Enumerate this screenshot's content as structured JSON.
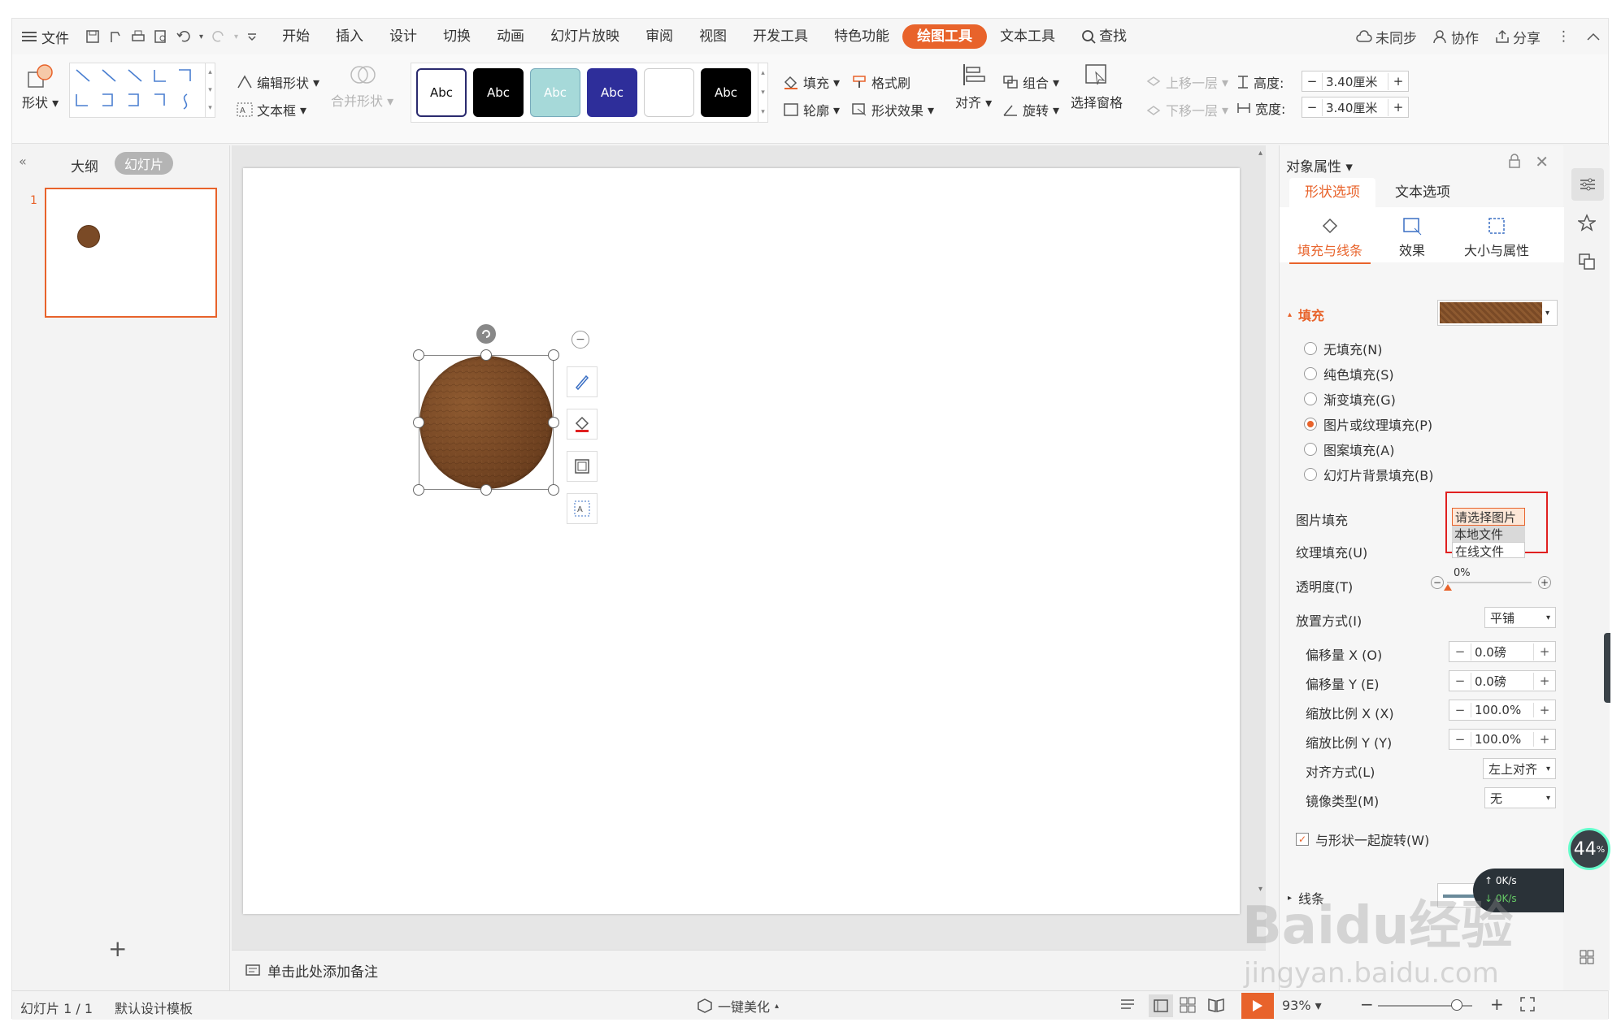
{
  "menubar": {
    "file": "文件",
    "tabs": [
      "开始",
      "插入",
      "设计",
      "切换",
      "动画",
      "幻灯片放映",
      "审阅",
      "视图",
      "开发工具",
      "特色功能",
      "绘图工具",
      "文本工具"
    ],
    "active_tab": "绘图工具",
    "search": "查找",
    "sync": "未同步",
    "collab": "协作",
    "share": "分享"
  },
  "ribbon": {
    "shape": "形状",
    "edit_shape": "编辑形状",
    "textbox": "文本框",
    "merge_shape": "合并形状",
    "style_label": "Abc",
    "fill": "填充",
    "format_painter": "格式刷",
    "outline": "轮廓",
    "shape_effect": "形状效果",
    "align": "对齐",
    "group": "组合",
    "rotate": "旋转",
    "selection_pane": "选择窗格",
    "bring_forward": "上移一层",
    "send_backward": "下移一层",
    "height_label": "高度:",
    "height_value": "3.40厘米",
    "width_label": "宽度:",
    "width_value": "3.40厘米"
  },
  "leftpane": {
    "outline_tab": "大纲",
    "slides_tab": "幻灯片",
    "slide_number": "1"
  },
  "notes": {
    "placeholder": "单击此处添加备注"
  },
  "panel": {
    "title": "对象属性",
    "tab_shape": "形状选项",
    "tab_text": "文本选项",
    "sub_fill_line": "填充与线条",
    "sub_effect": "效果",
    "sub_size": "大小与属性",
    "fill_header": "填充",
    "fill_options": [
      "无填充(N)",
      "纯色填充(S)",
      "渐变填充(G)",
      "图片或纹理填充(P)",
      "图案填充(A)",
      "幻灯片背景填充(B)"
    ],
    "picture_fill_label": "图片填充",
    "picture_fill_value": "请选择图片",
    "picture_menu": [
      "本地文件",
      "在线文件"
    ],
    "texture_fill_label": "纹理填充(U)",
    "transparency_label": "透明度(T)",
    "transparency_value": "0%",
    "placement_label": "放置方式(I)",
    "placement_value": "平铺",
    "offset_x_label": "偏移量 X (O)",
    "offset_x_value": "0.0磅",
    "offset_y_label": "偏移量 Y (E)",
    "offset_y_value": "0.0磅",
    "scale_x_label": "缩放比例 X (X)",
    "scale_x_value": "100.0%",
    "scale_y_label": "缩放比例 Y (Y)",
    "scale_y_value": "100.0%",
    "align_label": "对齐方式(L)",
    "align_value": "左上对齐",
    "mirror_label": "镜像类型(M)",
    "mirror_value": "无",
    "rotate_with_shape": "与形状一起旋转(W)",
    "line_header": "线条"
  },
  "status": {
    "slide_info": "幻灯片 1 / 1",
    "template": "默认设计模板",
    "beautify": "一键美化",
    "zoom": "93%"
  },
  "speed_widget": {
    "percent": "44",
    "unit": "%",
    "up": "0K/s",
    "down": "0K/s"
  },
  "watermark": {
    "logo": "Baidu经验",
    "url": "jingyan.baidu.com"
  },
  "colors": {
    "accent": "#e8632b",
    "leather": "#7a4a26",
    "highlight_box": "#e02020"
  }
}
